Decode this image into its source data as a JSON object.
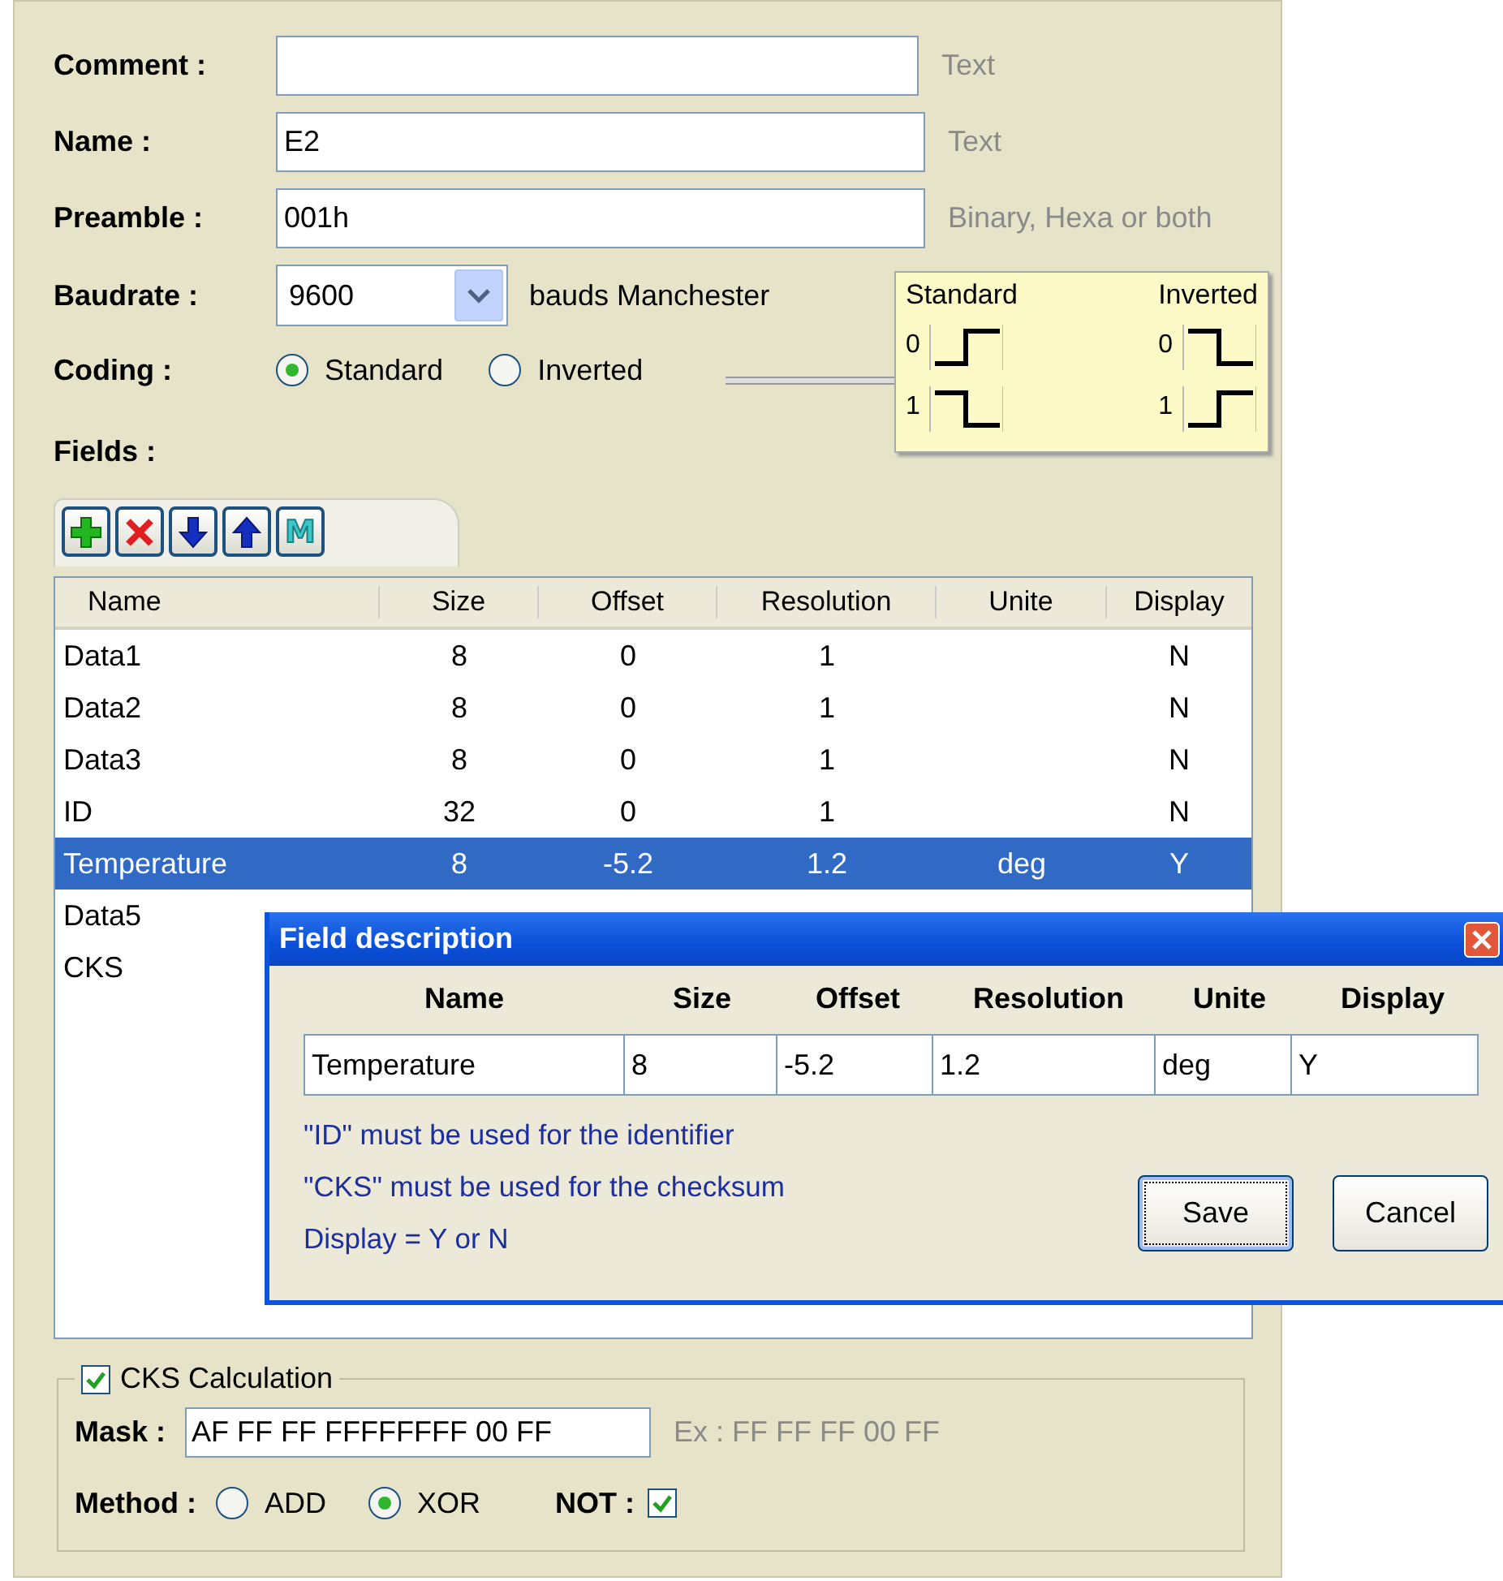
{
  "form": {
    "rows": [
      {
        "label": "Comment :",
        "hint": "Text"
      },
      {
        "label": "Name :",
        "value": "E2",
        "hint": "Text"
      },
      {
        "label": "Preamble :",
        "value": "001h",
        "hint": "Binary, Hexa or both"
      }
    ],
    "baudrate": {
      "label": "Baudrate :",
      "value": "9600",
      "suffix": "bauds Manchester"
    },
    "coding": {
      "label": "Coding :",
      "options": [
        {
          "label": "Standard",
          "selected": true
        },
        {
          "label": "Inverted",
          "selected": false
        }
      ]
    },
    "coding_legend": {
      "columns": [
        {
          "title": "Standard",
          "kind": "standard",
          "bits": [
            "0",
            "1"
          ]
        },
        {
          "title": "Inverted",
          "kind": "inverted",
          "bits": [
            "0",
            "1"
          ]
        }
      ]
    }
  },
  "fields": {
    "label": "Fields :",
    "toolbar": [
      {
        "kind": "add"
      },
      {
        "kind": "delete"
      },
      {
        "kind": "down"
      },
      {
        "kind": "up"
      },
      {
        "kind": "letter",
        "label": "M"
      }
    ],
    "table": {
      "columns": [
        "Name",
        "Size",
        "Offset",
        "Resolution",
        "Unite",
        "Display"
      ],
      "rows": [
        {
          "cells": [
            "Data1",
            "8",
            "0",
            "1",
            "",
            "N"
          ],
          "selected": false
        },
        {
          "cells": [
            "Data2",
            "8",
            "0",
            "1",
            "",
            "N"
          ],
          "selected": false
        },
        {
          "cells": [
            "Data3",
            "8",
            "0",
            "1",
            "",
            "N"
          ],
          "selected": false
        },
        {
          "cells": [
            "ID",
            "32",
            "0",
            "1",
            "",
            "N"
          ],
          "selected": false
        },
        {
          "cells": [
            "Temperature",
            "8",
            "-5.2",
            "1.2",
            "deg",
            "Y"
          ],
          "selected": true
        },
        {
          "cells": [
            "Data5"
          ],
          "selected": false
        },
        {
          "cells": [
            "CKS"
          ],
          "selected": false
        }
      ]
    }
  },
  "dialog": {
    "title": "Field description",
    "columns": [
      "Name",
      "Size",
      "Offset",
      "Resolution",
      "Unite",
      "Display"
    ],
    "values": [
      "Temperature",
      "8",
      "-5.2",
      "1.2",
      "deg",
      "Y"
    ],
    "notes": [
      "\"ID\" must be used for the identifier",
      "\"CKS\" must be used for the checksum",
      "Display = Y or N"
    ],
    "buttons": [
      {
        "label": "Save",
        "focused": true
      },
      {
        "label": "Cancel",
        "focused": false
      }
    ]
  },
  "cks": {
    "label": "CKS Calculation",
    "checked": true,
    "mask": {
      "label": "Mask :",
      "value": "AF FF FF FFFFFFFF 00 FF",
      "hint": "Ex : FF FF FF 00 FF"
    },
    "method": {
      "label": "Method :",
      "options": [
        {
          "label": "ADD",
          "selected": false
        },
        {
          "label": "XOR",
          "selected": true
        }
      ]
    },
    "not": {
      "label": "NOT :",
      "checked": true
    }
  }
}
